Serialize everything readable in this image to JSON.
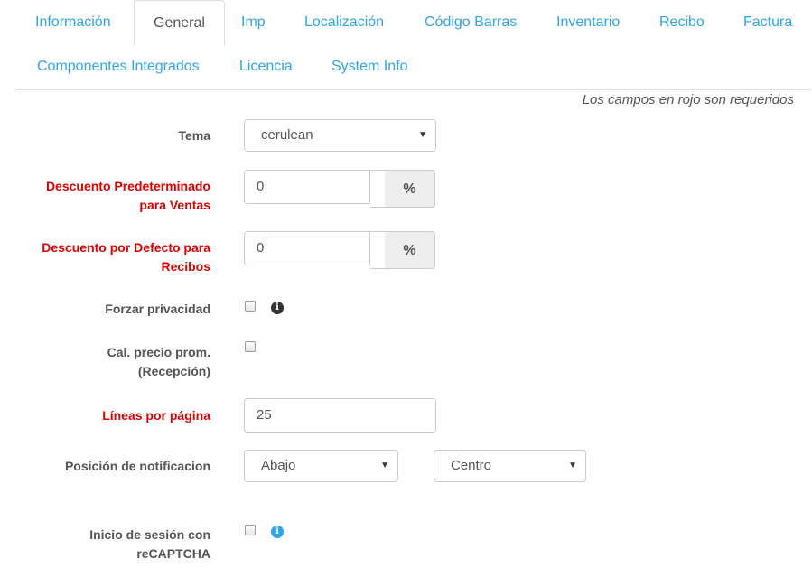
{
  "tabs": [
    {
      "label": "Información"
    },
    {
      "label": "General"
    },
    {
      "label": "Imp"
    },
    {
      "label": "Localización"
    },
    {
      "label": "Código Barras"
    },
    {
      "label": "Inventario"
    },
    {
      "label": "Recibo"
    },
    {
      "label": "Factura"
    },
    {
      "label": "Componentes Integrados"
    },
    {
      "label": "Licencia"
    },
    {
      "label": "System Info"
    }
  ],
  "active_tab": "General",
  "required_note": "Los campos en rojo son requeridos",
  "form": {
    "tema": {
      "label": "Tema",
      "value": "cerulean"
    },
    "descuento_ventas": {
      "label_line1": "Descuento Predeterminado",
      "label_line2": "para Ventas",
      "value": "0",
      "addon": "%"
    },
    "descuento_recibos": {
      "label_line1": "Descuento por Defecto para",
      "label_line2": "Recibos",
      "value": "0",
      "addon": "%"
    },
    "forzar_privacidad": {
      "label": "Forzar privacidad",
      "checked": false
    },
    "cal_precio": {
      "label_line1": "Cal. precio prom.",
      "label_line2": "(Recepción)",
      "checked": false
    },
    "lineas": {
      "label": "Líneas por página",
      "value": "25"
    },
    "posicion": {
      "label": "Posición de notificacion",
      "vertical": "Abajo",
      "horizontal": "Centro"
    },
    "recaptcha": {
      "label_line1": "Inicio de sesión con",
      "label_line2": "reCAPTCHA",
      "checked": false
    }
  },
  "colors": {
    "link": "#2fa4e7",
    "required": "#e00000",
    "text": "#555555"
  }
}
